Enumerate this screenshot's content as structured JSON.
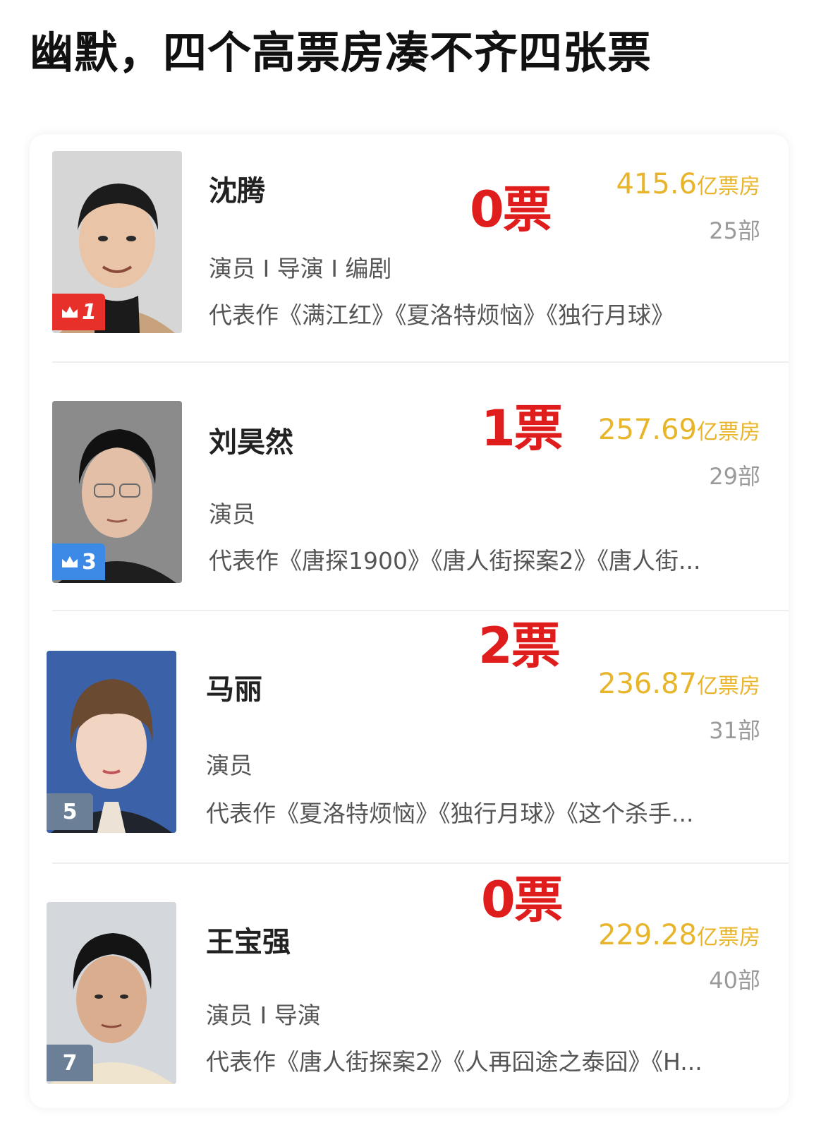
{
  "headline": "幽默，四个高票房凑不齐四张票",
  "box_office_unit": "亿票房",
  "colors": {
    "votes_red": "#e01d1d",
    "box_office_gold": "#e8b52a",
    "rank_top_red": "#e8302a",
    "rank_blue": "#3d8ae6",
    "rank_plain": "#6b7f96"
  },
  "rows": [
    {
      "name": "沈腾",
      "votes": "0票",
      "box_office": "415.6",
      "films": "25部",
      "roles": "演员 I 导演 I 编剧",
      "works": "代表作《满江红》《夏洛特烦恼》《独行月球》",
      "rank": "1",
      "rank_icon": "crown-icon"
    },
    {
      "name": "刘昊然",
      "votes": "1票",
      "box_office": "257.69",
      "films": "29部",
      "roles": "演员",
      "works": "代表作《唐探1900》《唐人街探案2》《唐人街...",
      "rank": "3",
      "rank_icon": "crown-icon"
    },
    {
      "name": "马丽",
      "votes": "2票",
      "box_office": "236.87",
      "films": "31部",
      "roles": "演员",
      "works": "代表作《夏洛特烦恼》《独行月球》《这个杀手...",
      "rank": "5"
    },
    {
      "name": "王宝强",
      "votes": "0票",
      "box_office": "229.28",
      "films": "40部",
      "roles": "演员 I 导演",
      "works": "代表作《唐人街探案2》《人再囧途之泰囧》《H...",
      "rank": "7"
    }
  ]
}
